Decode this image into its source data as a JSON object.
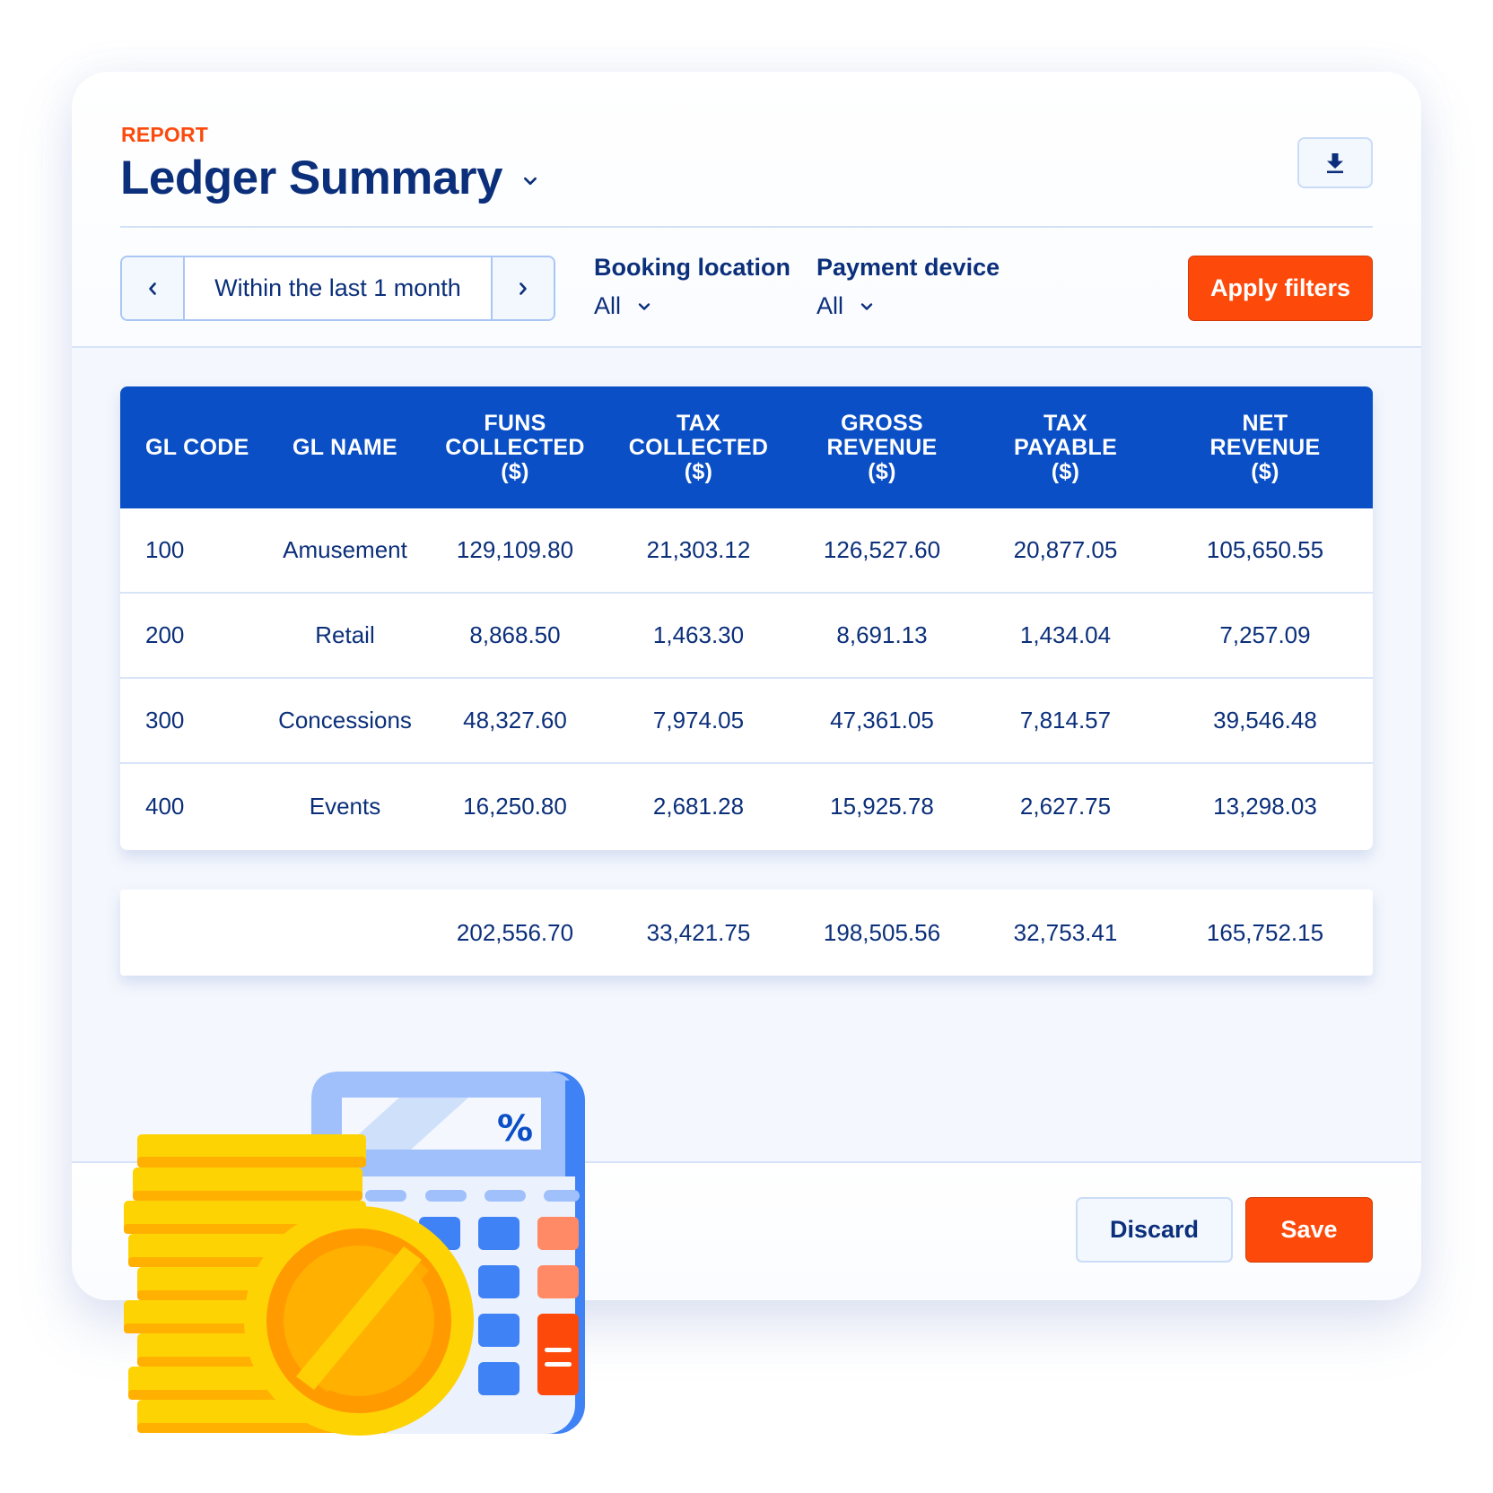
{
  "header": {
    "eyebrow": "REPORT",
    "title": "Ledger Summary",
    "title_dropdown_icon": "chevron-down-icon",
    "download_icon": "download-icon"
  },
  "filters": {
    "date_range": {
      "value": "Within the last 1 month",
      "prev_icon": "chevron-left-icon",
      "next_icon": "chevron-right-icon"
    },
    "booking_location": {
      "label": "Booking location",
      "value": "All"
    },
    "payment_device": {
      "label": "Payment device",
      "value": "All"
    },
    "apply_label": "Apply filters"
  },
  "table": {
    "columns": [
      "GL CODE",
      "GL NAME",
      "FUNS\nCOLLECTED\n($)",
      "TAX\nCOLLECTED\n($)",
      "GROSS\nREVENUE\n($)",
      "TAX\nPAYABLE\n($)",
      "NET\nREVENUE\n($)"
    ],
    "rows": [
      [
        "100",
        "Amusement",
        "129,109.80",
        "21,303.12",
        "126,527.60",
        "20,877.05",
        "105,650.55"
      ],
      [
        "200",
        "Retail",
        "8,868.50",
        "1,463.30",
        "8,691.13",
        "1,434.04",
        "7,257.09"
      ],
      [
        "300",
        "Concessions",
        "48,327.60",
        "7,974.05",
        "47,361.05",
        "7,814.57",
        "39,546.48"
      ],
      [
        "400",
        "Events",
        "16,250.80",
        "2,681.28",
        "15,925.78",
        "2,627.75",
        "13,298.03"
      ]
    ],
    "totals": [
      "",
      "",
      "202,556.70",
      "33,421.75",
      "198,505.56",
      "32,753.41",
      "165,752.15"
    ]
  },
  "footer": {
    "discard_label": "Discard",
    "save_label": "Save"
  },
  "illustration": {
    "calculator_display": "%",
    "equals_key": "="
  },
  "colors": {
    "accent_orange": "#fd4a0b",
    "primary_blue": "#0a4fc6",
    "text_navy": "#0b2f7a",
    "coin_yellow": "#fed303",
    "coin_shade": "#ffb000"
  }
}
